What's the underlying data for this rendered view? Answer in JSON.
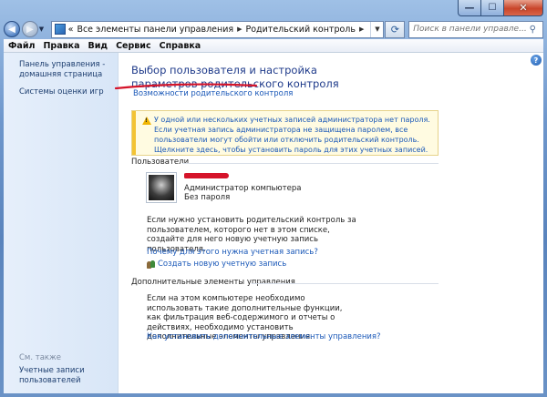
{
  "window": {
    "caption_buttons": {
      "minimize": "—",
      "maximize": "☐",
      "close": "✕"
    }
  },
  "nav": {
    "back_icon": "back-arrow-icon",
    "forward_icon": "forward-arrow-icon",
    "address": {
      "root_prefix": "«",
      "crumbs": [
        "Все элементы панели управления",
        "Родительский контроль"
      ]
    },
    "refresh_icon": "refresh-icon",
    "search_placeholder": "Поиск в панели управле..."
  },
  "menu": {
    "items": [
      "Файл",
      "Правка",
      "Вид",
      "Сервис",
      "Справка"
    ]
  },
  "sidebar": {
    "links": [
      "Панель управления -\nдомашняя страница",
      "Системы оценки игр"
    ],
    "see_also_heading": "См. также",
    "see_also_links": [
      "Учетные записи\nпользователей"
    ]
  },
  "main": {
    "title": "Выбор пользователя и настройка параметров родительского контроля",
    "capabilities_link": "Возможности родительского контроля",
    "warning_text": "У одной или нескольких учетных записей администратора нет пароля. Если учетная запись администратора не защищена паролем, все пользователи могут обойти или отключить родительский контроль. Щелкните здесь, чтобы установить пароль для этих учетных записей.",
    "users_heading": "Пользователи",
    "user": {
      "role": "Администратор компьютера",
      "password_status": "Без пароля"
    },
    "account_help_text": "Если нужно установить родительский контроль за пользователем, которого нет в этом списке, создайте для него новую учетную запись пользователя.",
    "why_account_link": "Почему для этого нужна учетная запись?",
    "create_account_link": "Создать новую учетную запись",
    "extra_heading": "Дополнительные элементы управления",
    "extra_text": "Если на этом компьютере необходимо использовать такие дополнительные функции, как фильтрация веб-содержимого и отчеты о действиях, необходимо установить дополнительные элементы управления.",
    "extra_link": "Как установить дополнительные элементы управления?"
  },
  "colors": {
    "link": "#1a58b8",
    "title": "#1e3a8a",
    "warning_stripe": "#f3c333",
    "annotation_red": "#d5142a"
  }
}
